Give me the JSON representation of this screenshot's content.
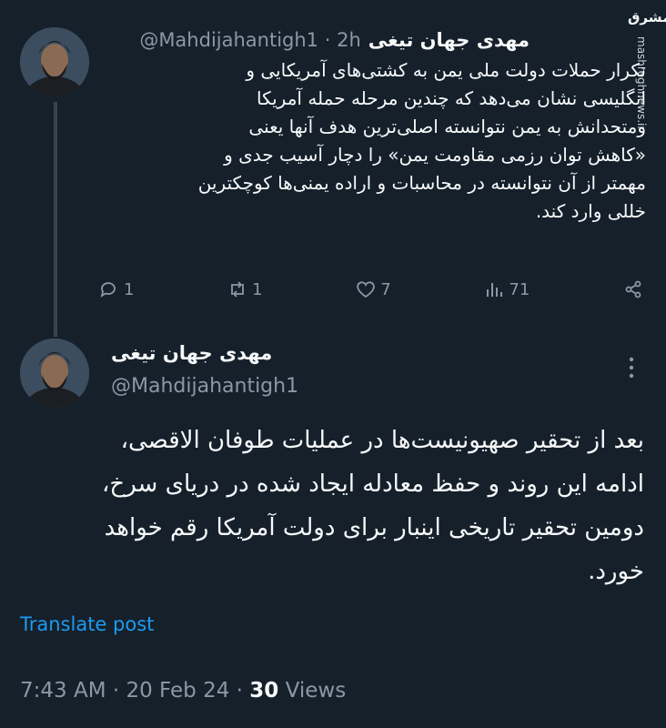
{
  "tweet1": {
    "author_name": "مهدی جهان تیغی",
    "handle": "@Mahdijahantigh1",
    "time": "· 2h",
    "text_lines": [
      "تکرار حملات دولت ملی یمن به کشتی‌های آمریکایی و",
      "انگلیسی نشان می‌دهد که چندین مرحله حمله آمریکا",
      "ومتحدانش به یمن نتوانسته اصلی‌ترین هدف آنها یعنی",
      "«کاهش توان رزمی مقاومت یمن» را دچار آسیب جدی و",
      "مهمتر از آن نتوانسته در محاسبات و اراده یمنی‌ها کوچکترین",
      "خللی وارد کند."
    ],
    "stats": {
      "replies": "1",
      "reposts": "1",
      "likes": "7",
      "views": "71"
    }
  },
  "tweet2": {
    "author_name": "مهدی جهان تیغی",
    "handle": "@Mahdijahantigh1",
    "text_lines": [
      "بعد از تحقیر صهیونیست‌ها در عملیات طوفان الاقصی،",
      "ادامه این روند و حفظ معادله ایجاد شده در دریای سرخ،",
      "دومین تحقیر تاریخی اینبار برای دولت آمریکا رقم خواهد",
      "خورد."
    ],
    "translate_label": "Translate post",
    "timestamp": "7:43 AM · 20 Feb 24 ·",
    "views_count": "30",
    "views_label": "Views"
  },
  "watermark": {
    "logo": "مشرق",
    "site": "mashreghnews.ir"
  },
  "colors": {
    "background": "#15202b",
    "text": "#f7f9f9",
    "muted": "#8b98a5",
    "link": "#1d9bf0"
  }
}
